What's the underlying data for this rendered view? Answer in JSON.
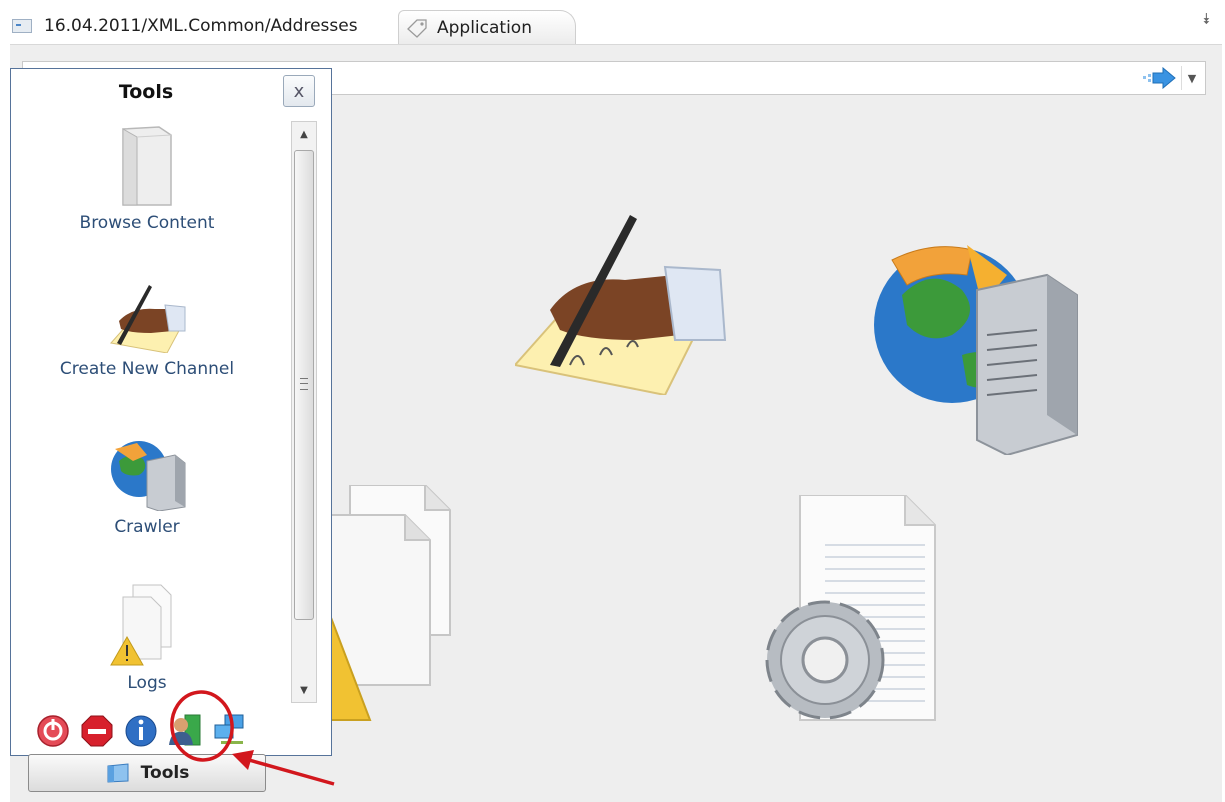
{
  "tabs": {
    "document_tab": "16.04.2011/XML.Common/Addresses",
    "application_tab": "Application"
  },
  "tools_panel": {
    "title": "Tools",
    "close_label": "x",
    "items": [
      {
        "label": "Browse Content",
        "icon": "binder-icon"
      },
      {
        "label": "Create New Channel",
        "icon": "signing-hand-icon"
      },
      {
        "label": "Crawler",
        "icon": "globe-server-icon"
      },
      {
        "label": "Logs",
        "icon": "log-warning-icon"
      }
    ],
    "bottom_icons": [
      "power-icon",
      "stop-icon",
      "info-icon",
      "user-icon",
      "network-icon"
    ]
  },
  "tools_button": {
    "label": "Tools"
  },
  "colors": {
    "accent": "#2d4e77",
    "annotation": "#d2171d",
    "panel_border": "#56739a"
  }
}
